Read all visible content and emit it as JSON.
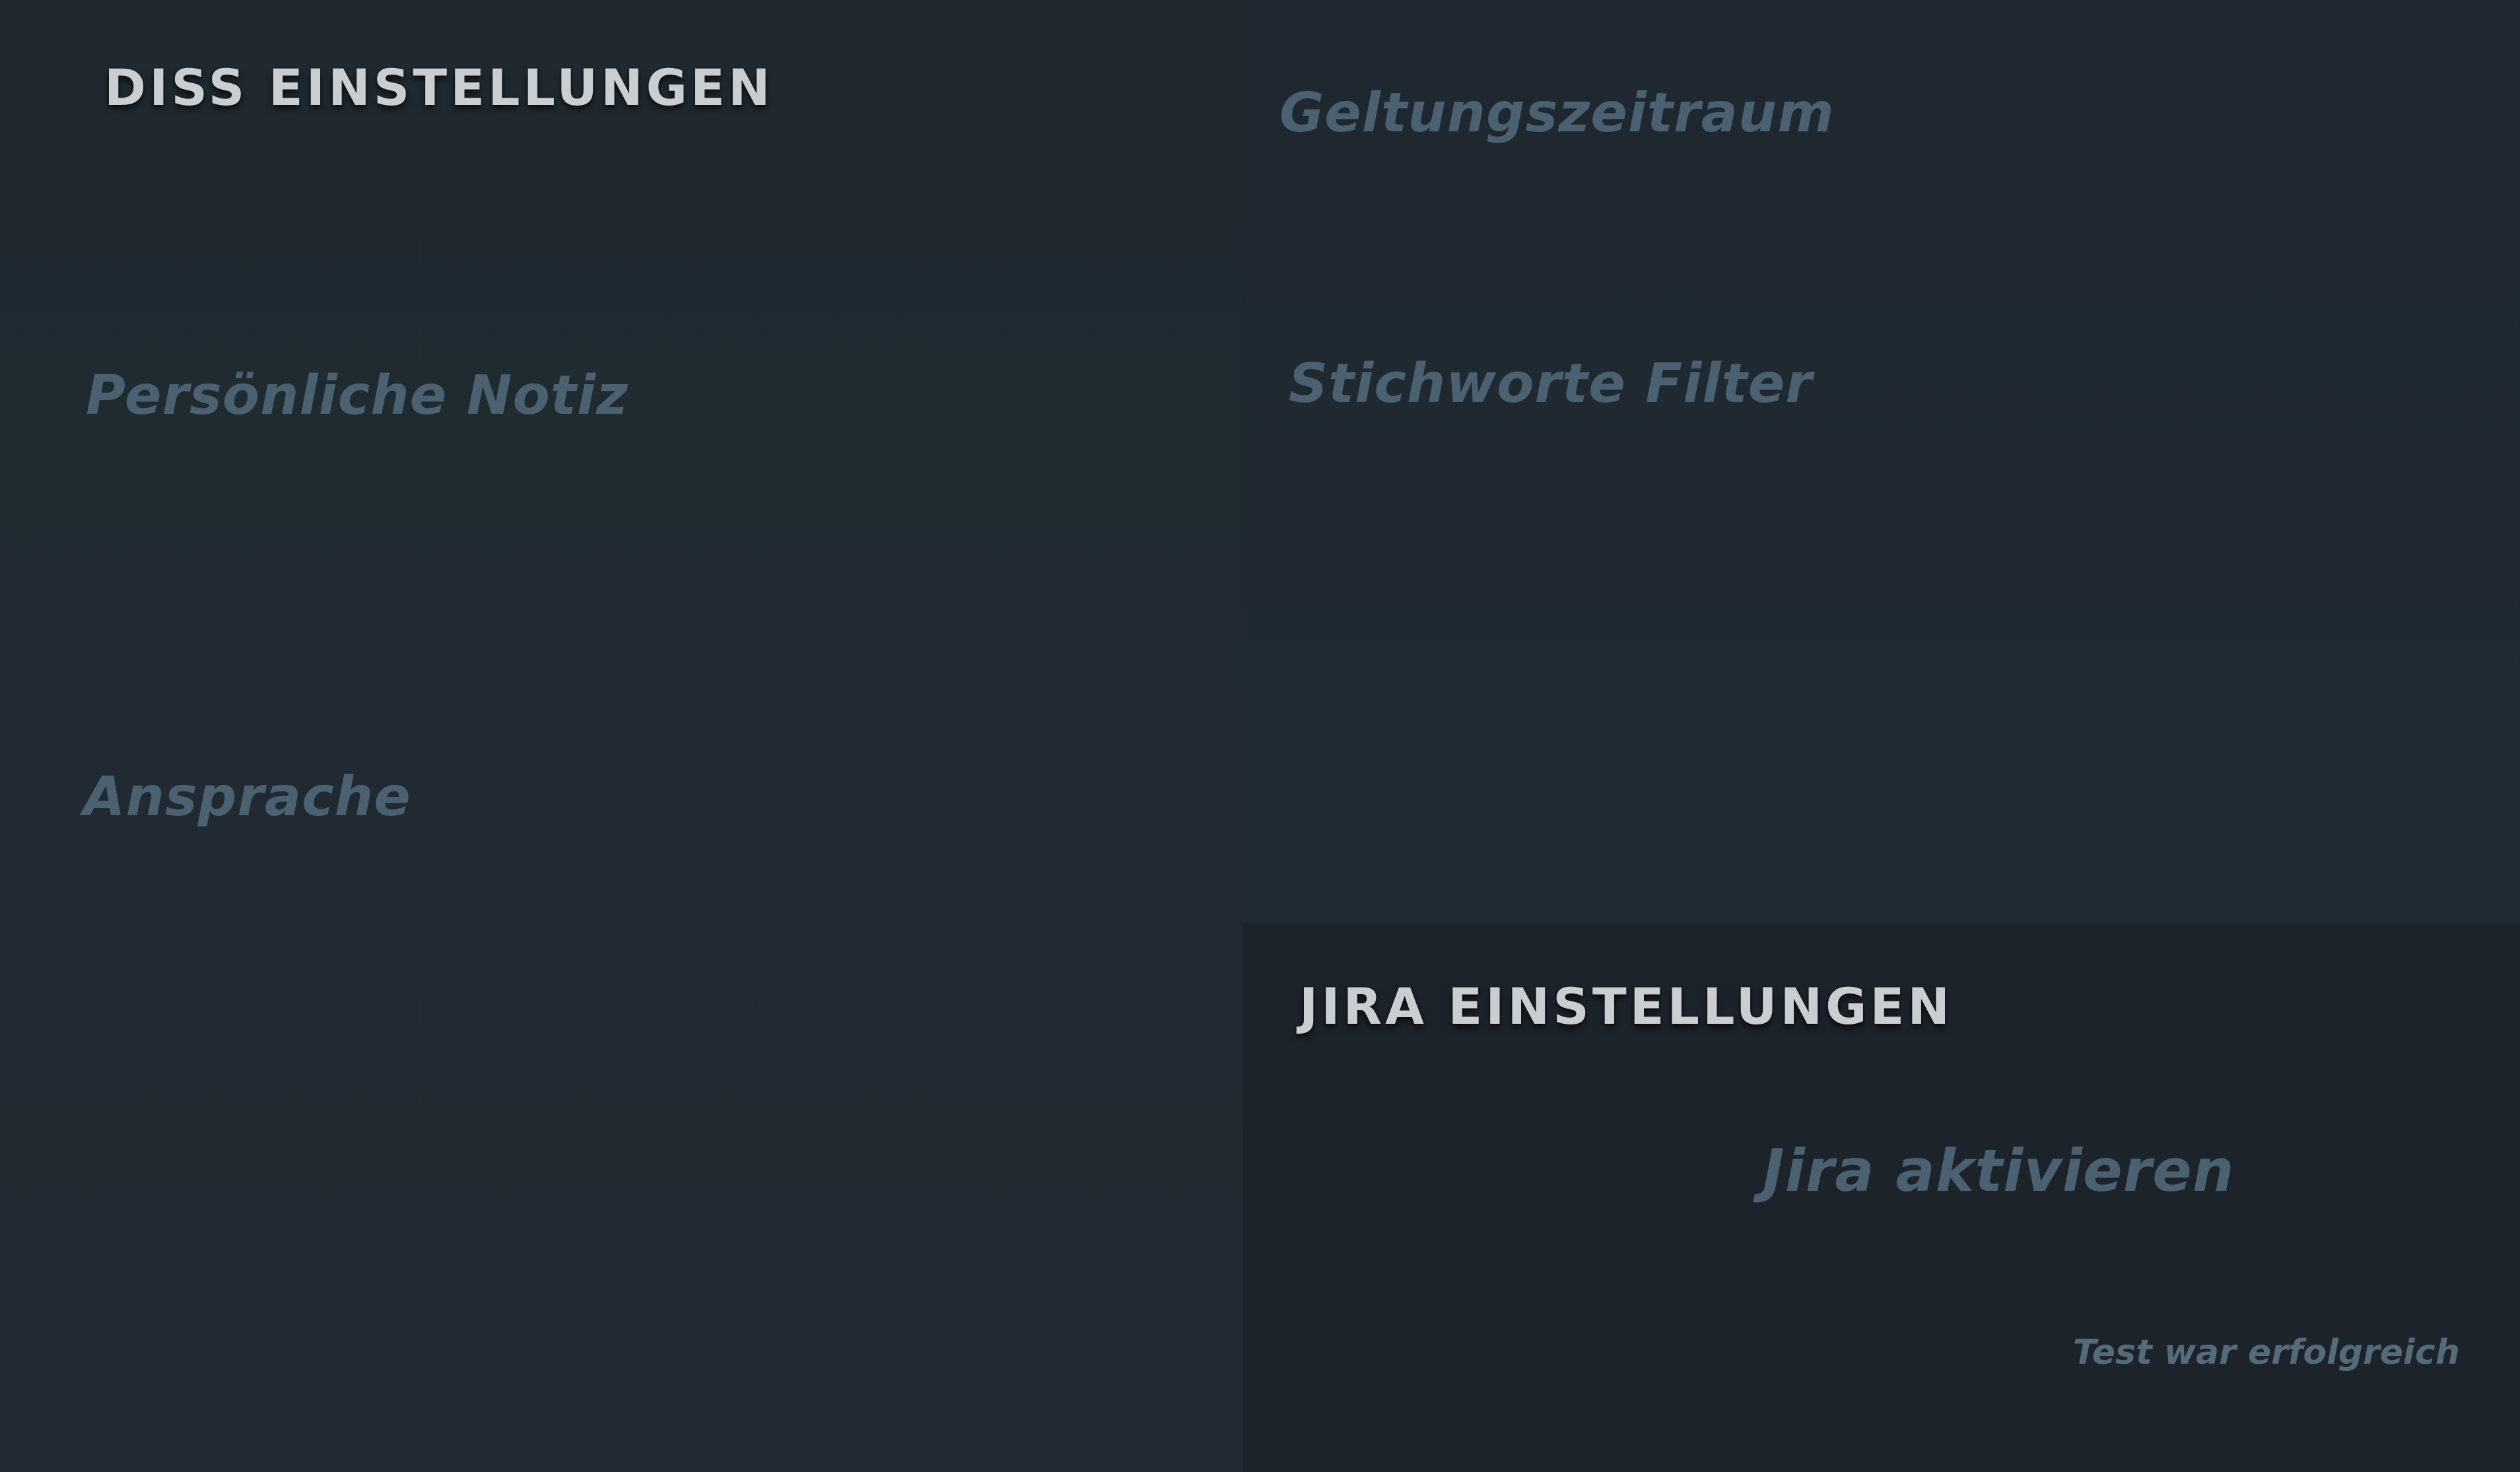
{
  "diss_settings": {
    "title": "DISS EINSTELLUNGEN",
    "personal_note_label": "Persönliche Notiz",
    "salutation_label": "Ansprache"
  },
  "filter_settings": {
    "validity_period_label": "Geltungszeitraum",
    "keyword_filter_label": "Stichworte Filter"
  },
  "jira_settings": {
    "title": "JIRA EINSTELLUNGEN",
    "activate_label": "Jira aktivieren",
    "test_status": "Test war erfolgreich"
  },
  "colors": {
    "background": "#212a33",
    "jira_panel_background": "#1d232b",
    "title_text": "#c9ced3",
    "label_text": "#4b6171"
  }
}
